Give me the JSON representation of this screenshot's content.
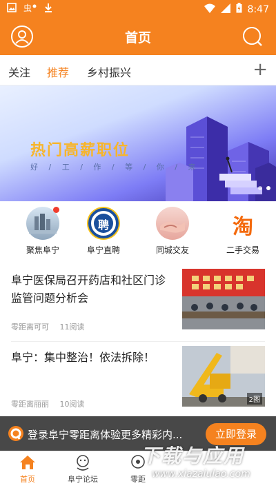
{
  "status_bar": {
    "time": "8:47",
    "left_icons": [
      "image-icon",
      "app-logo-icon",
      "download-icon"
    ],
    "right_icons": [
      "wifi-icon",
      "signal-icon",
      "battery-icon"
    ]
  },
  "app_bar": {
    "title": "首页",
    "left_icon": "user-icon",
    "right_icon": "search-icon"
  },
  "tabs": {
    "items": [
      "关注",
      "推荐",
      "乡村振兴"
    ],
    "active": "推荐",
    "add_icon": "+"
  },
  "banner": {
    "headline": "热门高薪职位",
    "subtitle": "好工作等你来",
    "subtitle_chars": [
      "好",
      "工",
      "作",
      "等",
      "你",
      "来"
    ]
  },
  "quick_links": [
    {
      "label": "聚焦阜宁",
      "icon": "city-photo-icon",
      "has_dot": true
    },
    {
      "label": "阜宁直聘",
      "icon": "hire-icon",
      "glyph": "聘",
      "has_dot": false
    },
    {
      "label": "同城交友",
      "icon": "handshake-icon",
      "has_dot": false
    },
    {
      "label": "二手交易",
      "icon": "taobao-icon",
      "glyph": "淘",
      "has_dot": false
    }
  ],
  "articles": [
    {
      "title": "阜宁医保局召开药店和社区门诊监管问题分析会",
      "source": "零距离可可",
      "reads": "11阅读",
      "badge": ""
    },
    {
      "title": "阜宁：集中整治！依法拆除！",
      "source": "零距离丽丽",
      "reads": "10阅读",
      "badge": "2图"
    }
  ],
  "login_bar": {
    "text": "登录阜宁零距离体验更多精彩内...",
    "button": "立即登录"
  },
  "bottom_nav": [
    {
      "label": "首页",
      "icon": "home-icon",
      "active": true
    },
    {
      "label": "阜宁论坛",
      "icon": "forum-icon",
      "active": false
    },
    {
      "label": "零距",
      "icon": "community-icon",
      "active": false
    }
  ],
  "watermark": {
    "title": "下载与应用",
    "url": "www.xiazaiulao.com"
  },
  "colors": {
    "brand": "#f5821f",
    "banner_headline": "#f7b52b",
    "red_dot": "#f03c2d"
  }
}
